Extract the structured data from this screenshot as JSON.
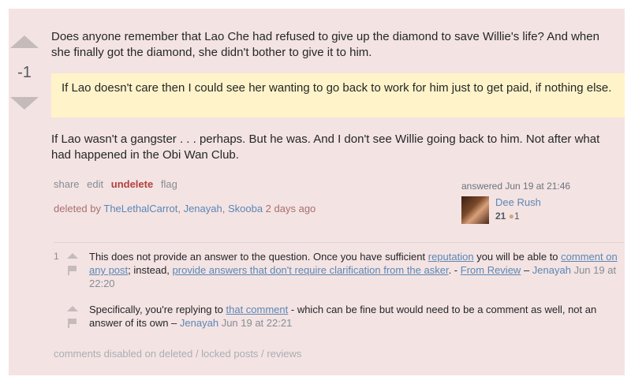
{
  "answer": {
    "score": "-1",
    "paragraph1": "Does anyone remember that Lao Che had refused to give up the diamond to save Willie's life? And when she finally got the diamond, she didn't bother to give it to him.",
    "quote": "If Lao doesn't care then I could see her wanting to go back to work for him just to get paid, if nothing else.",
    "paragraph2": "If Lao wasn't a gangster . . . perhaps. But he was. And I don't see Willie going back to him. Not after what had happened in the Obi Wan Club."
  },
  "menu": {
    "share": "share",
    "edit": "edit",
    "undelete": "undelete",
    "flag": "flag"
  },
  "deleted": {
    "prefix": "deleted by ",
    "users": [
      "TheLethalCarrot",
      "Jenayah",
      "Skooba"
    ],
    "suffix": "2 days ago"
  },
  "user_card": {
    "answered": "answered Jun 19 at 21:46",
    "name": "Dee Rush",
    "reputation": "21",
    "badge_icon": "bronze-badge-icon",
    "badge_count": "1"
  },
  "comments": [
    {
      "score": "1",
      "text_a": "This does not provide an answer to the question. Once you have sufficient ",
      "link_a": "reputation",
      "text_b": " you will be able to ",
      "link_b": "comment on any post",
      "text_c": "; instead, ",
      "link_c": "provide answers that don't require clarification from the asker",
      "text_d": ". - ",
      "link_d": "From Review",
      "dash": " – ",
      "user": "Jenayah",
      "date": "Jun 19 at 22:20"
    },
    {
      "score": "",
      "text_a": "Specifically, you're replying to ",
      "link_a": "that comment",
      "text_b": " - which can be fine but would need to be a comment as well, not an answer of its own",
      "dash": " – ",
      "user": "Jenayah",
      "date": "Jun 19 at 22:21"
    }
  ],
  "comments_disabled": "comments disabled on deleted / locked posts / reviews",
  "colors": {
    "deleted_background": "#f4e3e3",
    "quote_background": "#fff3c9",
    "link": "#5a87b4",
    "undelete": "#b0413e"
  }
}
